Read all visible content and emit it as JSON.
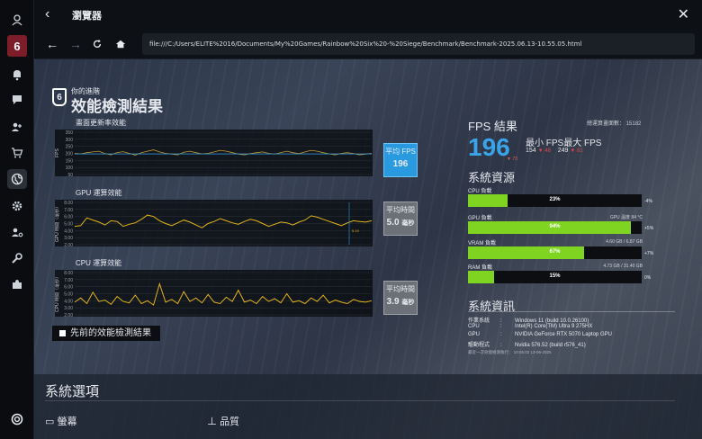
{
  "window": {
    "title": "瀏覽器"
  },
  "address_bar": {
    "url": "file:///C:/Users/ELITE%2016/Documents/My%20Games/Rainbow%20Six%20-%20Siege/Benchmark/Benchmark-2025.06.13-10.55.05.html"
  },
  "sidebar": {
    "logo_text": "6",
    "icons": [
      "user-icon",
      "bell-icon",
      "chat-icon",
      "friends-icon",
      "cart-icon",
      "globe-icon",
      "gear-icon",
      "people-settings-icon",
      "wrench-icon",
      "puzzle-icon",
      "ubisoft-logo-icon"
    ]
  },
  "header": {
    "badge": "6",
    "subtitle": "你的進階",
    "title": "效能檢測結果"
  },
  "charts": {
    "fps": {
      "label": "畫面更新率效能",
      "y_axis": "FPS",
      "ticks": [
        "350",
        "300",
        "250",
        "200",
        "150",
        "100",
        "50"
      ],
      "avg_label": "平均 FPS",
      "avg_value": "196"
    },
    "gpu": {
      "label": "GPU 運算效能",
      "y_axis": "GPU 時間（毫秒）",
      "ticks": [
        "8.00",
        "7.00",
        "6.00",
        "5.00",
        "4.00",
        "3.00",
        "2.00"
      ],
      "avg_label": "平均時間",
      "avg_value": "5.0",
      "avg_unit": "毫秒",
      "marker": "5.19"
    },
    "cpu": {
      "label": "CPU 運算效能",
      "y_axis": "CPU 時間（毫秒）",
      "ticks": [
        "8.00",
        "7.00",
        "6.00",
        "5.00",
        "4.00",
        "3.00",
        "2.00"
      ],
      "avg_label": "平均時間",
      "avg_value": "3.9",
      "avg_unit": "毫秒"
    }
  },
  "chart_data": [
    {
      "type": "line",
      "title": "畫面更新率效能",
      "ylabel": "FPS",
      "ylim": [
        50,
        350
      ],
      "series": [
        {
          "values": [
            200,
            196,
            205,
            210,
            215,
            198,
            190,
            206,
            212,
            200,
            188,
            205,
            215,
            225,
            210,
            200,
            195,
            190,
            208,
            215,
            205,
            196,
            200,
            210,
            222,
            215,
            205,
            195,
            190,
            198,
            205,
            210,
            200,
            194,
            206,
            215,
            205,
            198,
            210,
            222,
            215,
            205,
            196,
            190,
            200,
            205,
            198,
            190,
            195,
            200
          ]
        }
      ],
      "avg": 196
    },
    {
      "type": "line",
      "title": "GPU 運算效能",
      "ylabel": "GPU 時間（毫秒）",
      "ylim": [
        2,
        8
      ],
      "series": [
        {
          "values": [
            4.6,
            4.7,
            5.8,
            5.5,
            5.2,
            4.8,
            5.4,
            5.3,
            4.6,
            4.9,
            5.1,
            5.6,
            6.2,
            6.0,
            5.4,
            5.0,
            4.7,
            5.1,
            5.5,
            5.2,
            4.8,
            4.4,
            5.0,
            5.3,
            5.7,
            5.4,
            5.1,
            4.9,
            5.3,
            5.6,
            5.4,
            5.0,
            4.6,
            4.9,
            5.2,
            5.1,
            4.8,
            5.2,
            5.5,
            6.1,
            5.9,
            5.6,
            5.3,
            5.0,
            4.7,
            5.1,
            5.4,
            5.3,
            5.2,
            5.4
          ]
        }
      ],
      "avg": 5.0
    },
    {
      "type": "line",
      "title": "CPU 運算效能",
      "ylabel": "CPU 時間（毫秒）",
      "ylim": [
        2,
        8
      ],
      "series": [
        {
          "values": [
            3.8,
            4.4,
            3.6,
            5.2,
            3.9,
            4.1,
            3.5,
            4.6,
            3.9,
            3.7,
            4.8,
            3.6,
            4.0,
            3.4,
            6.4,
            3.8,
            4.2,
            3.6,
            5.3,
            3.9,
            4.4,
            3.7,
            4.9,
            3.8,
            3.6,
            4.5,
            3.9,
            5.5,
            3.8,
            4.1,
            3.6,
            4.6,
            3.9,
            4.3,
            3.7,
            5.0,
            3.8,
            4.0,
            3.6,
            4.4,
            3.9,
            4.8,
            3.7,
            4.1,
            3.8,
            3.6,
            4.2,
            3.9,
            3.8,
            4.0
          ]
        }
      ],
      "avg": 3.9
    }
  ],
  "prev_results_button": "先前的效能檢測結果",
  "fps_results": {
    "title": "FPS 結果",
    "runtime_label": "總運算畫面數：",
    "runtime_value": "15182",
    "avg_fps": "196",
    "avg_fps_sub": "▼ 73",
    "min_label": "最小 FPS",
    "max_label": "最大 FPS",
    "min_value": "154",
    "min_sub": "▼ 48",
    "max_value": "249",
    "max_sub": "▼ 81"
  },
  "system_resources": {
    "title": "系統資源",
    "bars": [
      {
        "label": "CPU 負載",
        "pct_text": "23%",
        "pct": 0.23,
        "side": "-4%",
        "extra": ""
      },
      {
        "label": "GPU 負載",
        "pct_text": "94%",
        "pct": 0.94,
        "side": "+5%",
        "extra": "GPU 溫度 84 °C"
      },
      {
        "label": "VRAM 負載",
        "pct_text": "67%",
        "pct": 0.67,
        "side": "+7%",
        "extra": "4.60 GB / 6.87 GB"
      },
      {
        "label": "RAM 負載",
        "pct_text": "15%",
        "pct": 0.15,
        "side": "0%",
        "extra": "4.73 GB / 31.40 GB"
      }
    ],
    "bar_color": "#7fd321"
  },
  "system_info": {
    "title": "系統資訊",
    "rows": [
      {
        "key": "作業系統",
        "value": "Windows 11 (build 10.0.26100)"
      },
      {
        "key": "CPU",
        "value": "Intel(R) Core(TM) Ultra 9 275HX"
      },
      {
        "key": "GPU",
        "value": "NVIDIA GeForce RTX 5070 Laptop GPU"
      },
      {
        "key": "驅動程式",
        "value": "Nvidia 576.52 (build r576_41)"
      }
    ],
    "footer": "最近一次效能檢測執行：    10:55:02 13-06-2025"
  },
  "system_options": {
    "title": "系統選項",
    "screen_label": "螢幕",
    "quality_label": "品質"
  },
  "colors": {
    "accent_blue": "#2a9ae0",
    "chart_line": "#e2b418",
    "fps_line": "#c49b3a",
    "avg_line": "#2a9ae0",
    "gauge_green": "#7fd321"
  }
}
